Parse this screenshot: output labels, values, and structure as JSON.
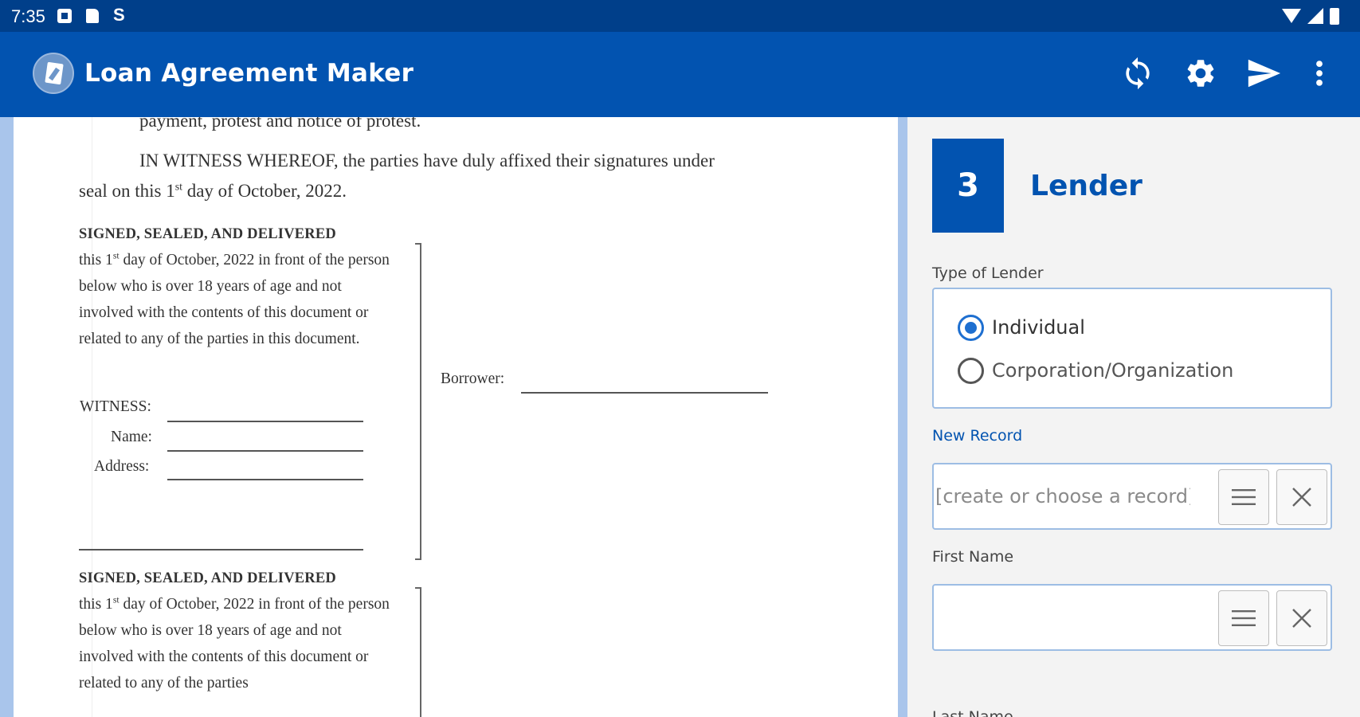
{
  "status_bar": {
    "time": "7:35",
    "icons": [
      "notification-icon",
      "sd-card-icon",
      "s-app-icon",
      "wifi-icon",
      "signal-icon",
      "battery-icon"
    ]
  },
  "app_bar": {
    "title": "Loan Agreement Maker",
    "actions": [
      "sync-icon",
      "settings-icon",
      "send-icon",
      "more-vert-icon"
    ],
    "color": "#0253b0"
  },
  "document": {
    "top_cut_line": "payment, protest and notice of protest.",
    "witness_para_line1": "IN WITNESS WHEREOF, the parties have duly affixed their signatures under",
    "witness_para_line2_pre": "seal on this 1",
    "witness_para_line2_sup": "st",
    "witness_para_line2_post": " day of October, 2022.",
    "block1": {
      "heading": "SIGNED, SEALED, AND DELIVERED",
      "body_pre": "this 1",
      "body_sup": "st",
      "body_post": " day of October, 2022 in front of the person below who is over 18 years of age and not involved with the contents of this document or related to any of the parties in this document.",
      "witness_label": "WITNESS:",
      "name_label": "Name:",
      "address_label": "Address:"
    },
    "borrower_label": "Borrower:",
    "block2": {
      "heading": "SIGNED, SEALED, AND DELIVERED",
      "body_pre": "this 1",
      "body_sup": "st",
      "body_post": " day of October, 2022 in front of the person below who is over 18 years of age and not involved with the contents of this document or related to any of the parties"
    }
  },
  "panel": {
    "step_number": "3",
    "step_title": "Lender",
    "type_label": "Type of Lender",
    "options": [
      {
        "label": "Individual",
        "checked": true
      },
      {
        "label": "Corporation/Organization",
        "checked": false
      }
    ],
    "new_record_label": "New Record",
    "new_record_placeholder": "[create or choose a record]",
    "first_name_label": "First Name",
    "first_name_value": "",
    "last_name_label": "Last Name"
  }
}
